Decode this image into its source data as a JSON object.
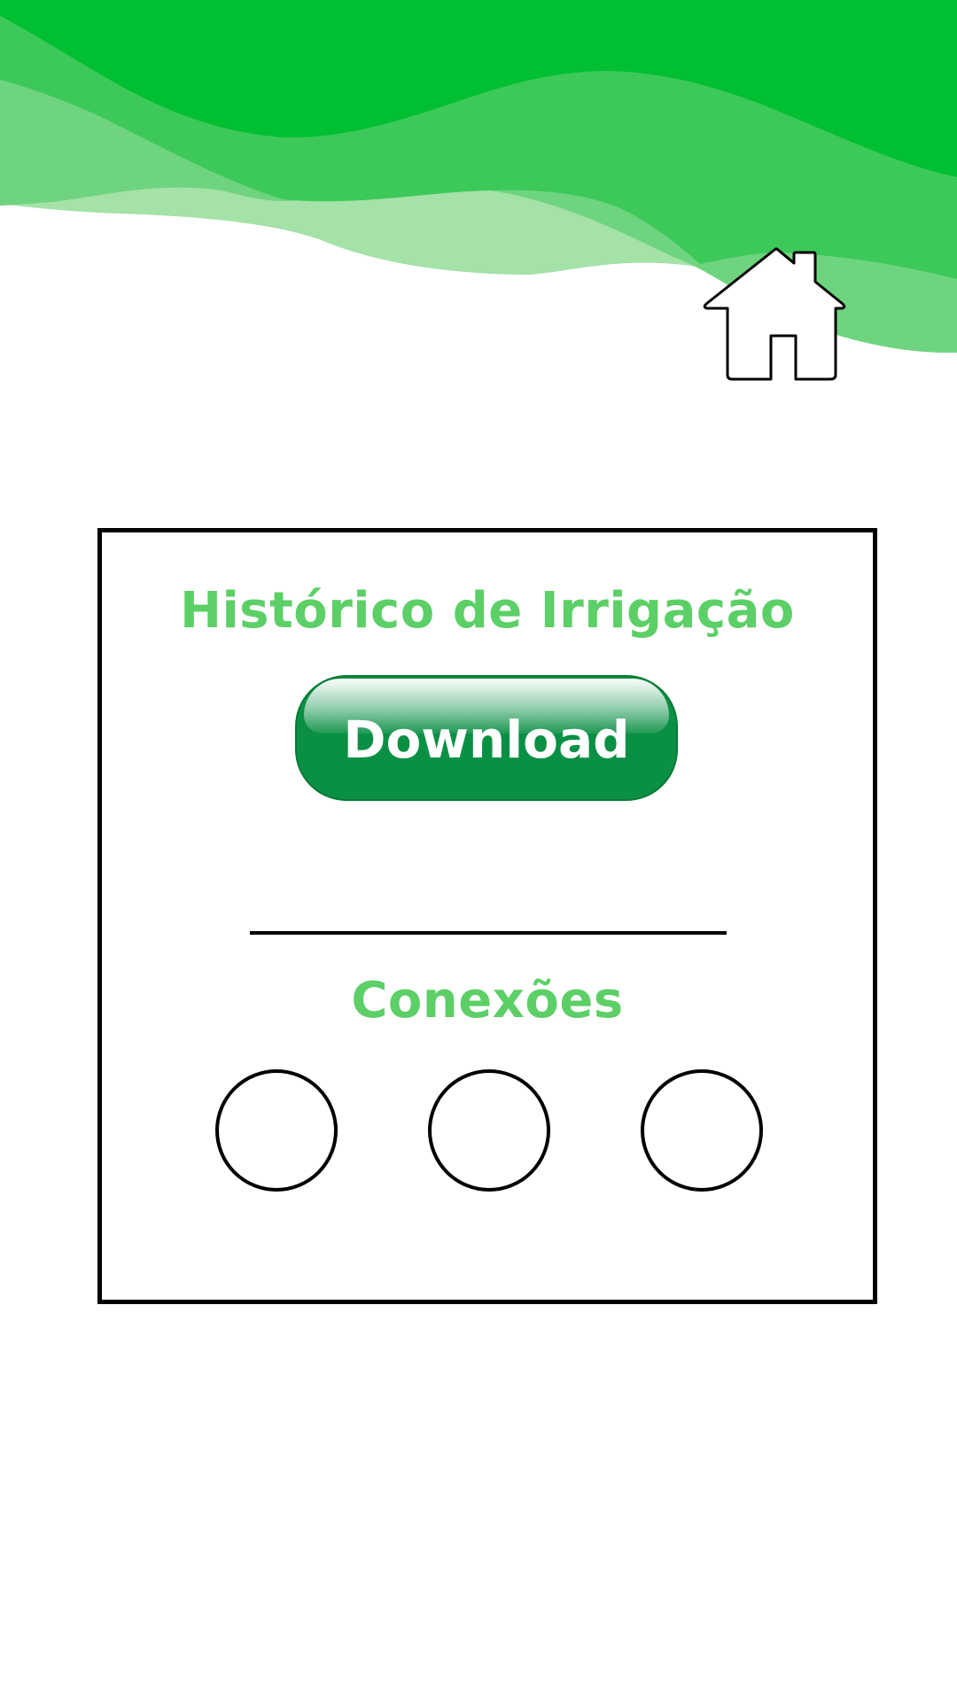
{
  "header": {
    "colors": {
      "wave_dark": "#00bf30",
      "wave_mid": "#3dc95a",
      "wave_light": "#6fd47f",
      "wave_pale": "#a4e2a8"
    },
    "home_icon": "home-icon"
  },
  "card": {
    "history_title": "Histórico de Irrigação",
    "download_button": {
      "label": "Download",
      "color": "#0a9044"
    },
    "connections_title": "Conexões",
    "connections": [
      {
        "icon": "circle-outline"
      },
      {
        "icon": "circle-outline"
      },
      {
        "icon": "circle-outline"
      }
    ],
    "title_color": "#5ccf67"
  }
}
